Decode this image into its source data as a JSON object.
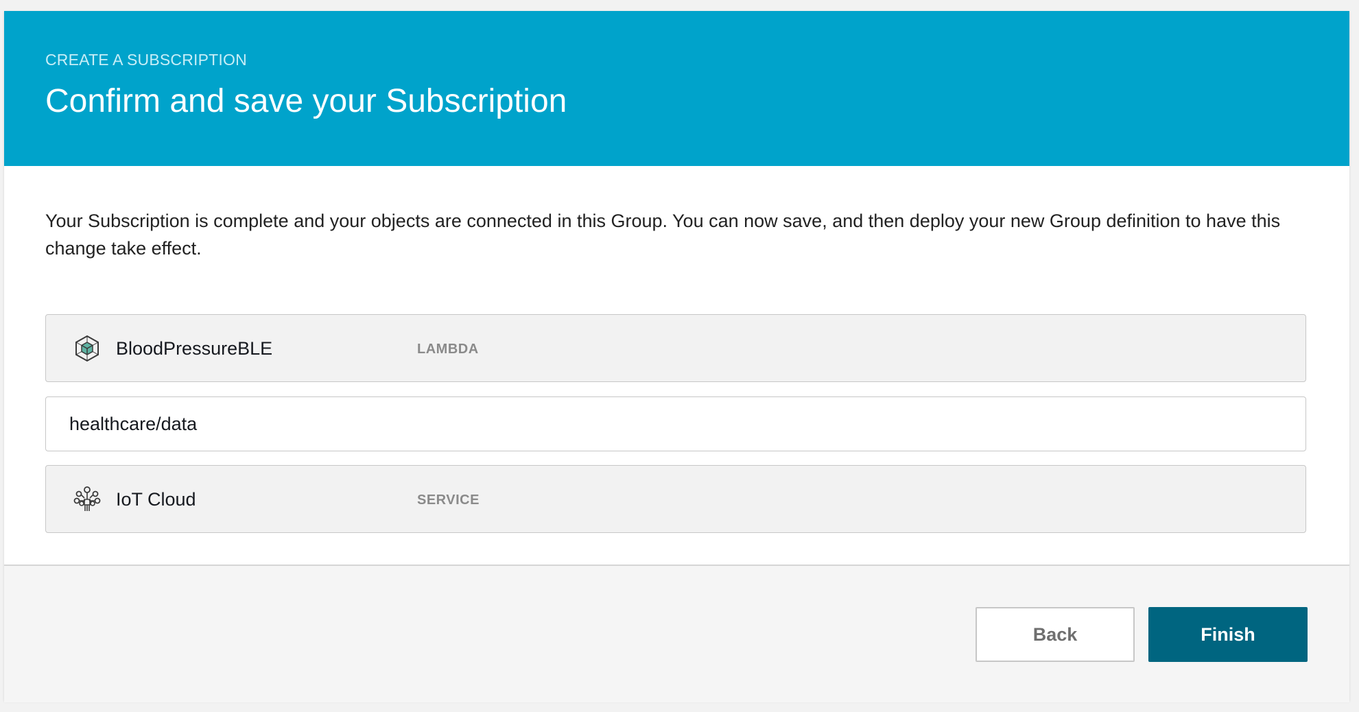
{
  "header": {
    "eyebrow": "CREATE A SUBSCRIPTION",
    "title": "Confirm and save your Subscription",
    "background_color": "#00a3cb"
  },
  "description": "Your Subscription is complete and your objects are connected in this Group. You can now save, and then deploy your new Group definition to have this change take effect.",
  "source": {
    "icon": "lambda-cube-icon",
    "name": "BloodPressureBLE",
    "type": "LAMBDA"
  },
  "topic": {
    "value": "healthcare/data"
  },
  "target": {
    "icon": "iot-cloud-icon",
    "name": "IoT Cloud",
    "type": "SERVICE"
  },
  "footer": {
    "back_label": "Back",
    "finish_label": "Finish",
    "finish_color": "#006580"
  }
}
